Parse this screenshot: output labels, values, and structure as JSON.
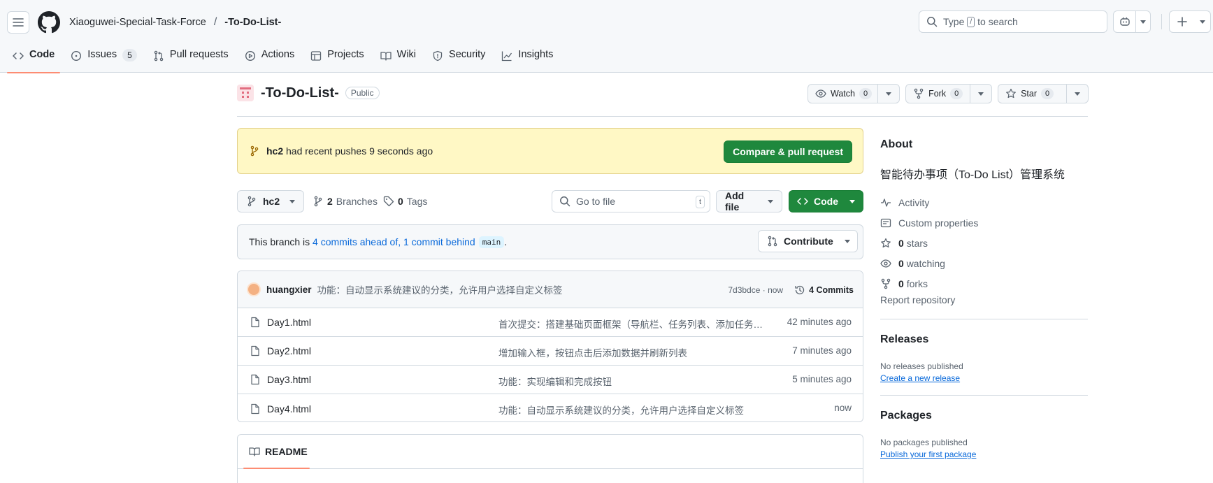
{
  "header": {
    "owner": "Xiaoguwei-Special-Task-Force",
    "separator": "/",
    "repo": "-To-Do-List-",
    "search_prefix": "Type",
    "search_key": "/",
    "search_suffix": "to search"
  },
  "nav": {
    "tabs": [
      {
        "label": "Code",
        "icon": "code-icon"
      },
      {
        "label": "Issues",
        "count": "5",
        "icon": "issue-icon"
      },
      {
        "label": "Pull requests",
        "icon": "pull-request-icon"
      },
      {
        "label": "Actions",
        "icon": "play-icon"
      },
      {
        "label": "Projects",
        "icon": "table-icon"
      },
      {
        "label": "Wiki",
        "icon": "book-icon"
      },
      {
        "label": "Security",
        "icon": "shield-icon"
      },
      {
        "label": "Insights",
        "icon": "graph-icon"
      }
    ],
    "accent": "#fd8c73"
  },
  "repo": {
    "name": "-To-Do-List-",
    "visibility": "Public",
    "watch": {
      "label": "Watch",
      "count": "0"
    },
    "fork": {
      "label": "Fork",
      "count": "0"
    },
    "star": {
      "label": "Star",
      "count": "0"
    }
  },
  "push_banner": {
    "branch": "hc2",
    "text": "had recent pushes 9 seconds ago",
    "button": "Compare & pull request",
    "background": "#fff8c5"
  },
  "toolbar": {
    "branch": "hc2",
    "branches_count": "2",
    "branches_label": "Branches",
    "tags_count": "0",
    "tags_label": "Tags",
    "goto_placeholder": "Go to file",
    "goto_key": "t",
    "add_file": "Add file",
    "code": "Code",
    "primary_color": "#1f883d"
  },
  "branch_status": {
    "prefix": "This branch is",
    "ahead": "4 commits ahead of,",
    "behind": "1 commit behind",
    "base": "main",
    "suffix": ".",
    "contribute": "Contribute"
  },
  "latest_commit": {
    "author": "huangxier",
    "message": "功能：自动显示系统建议的分类，允许用户选择自定义标签",
    "hash_time": "7d3bdce · now",
    "commits_label": "4 Commits"
  },
  "files": [
    {
      "name": "Day1.html",
      "message": "首次提交：搭建基础页面框架（导航栏、任务列表、添加任务按钮）",
      "age": "42 minutes ago"
    },
    {
      "name": "Day2.html",
      "message": "增加输入框，按钮点击后添加数据并刷新列表",
      "age": "7 minutes ago"
    },
    {
      "name": "Day3.html",
      "message": "功能：实现编辑和完成按钮",
      "age": "5 minutes ago"
    },
    {
      "name": "Day4.html",
      "message": "功能：自动显示系统建议的分类，允许用户选择自定义标签",
      "age": "now"
    }
  ],
  "readme": {
    "label": "README"
  },
  "sidebar": {
    "about_title": "About",
    "description": "智能待办事项（To-Do List）管理系统",
    "items": [
      {
        "icon": "pulse-icon",
        "label": "Activity"
      },
      {
        "icon": "note-icon",
        "label": "Custom properties"
      },
      {
        "icon": "star-icon",
        "count": "0",
        "label": "stars"
      },
      {
        "icon": "eye-icon",
        "count": "0",
        "label": "watching"
      },
      {
        "icon": "fork-icon",
        "count": "0",
        "label": "forks"
      }
    ],
    "report": "Report repository",
    "releases_title": "Releases",
    "releases_none": "No releases published",
    "releases_link": "Create a new release",
    "packages_title": "Packages",
    "packages_none": "No packages published",
    "packages_link": "Publish your first package"
  }
}
